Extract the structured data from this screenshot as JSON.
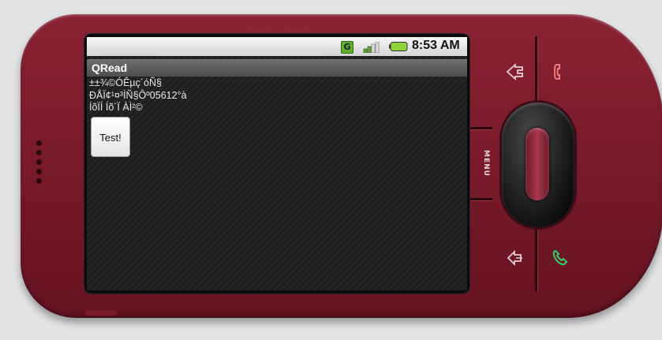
{
  "status_bar": {
    "network_badge": "G",
    "time": "8:53 AM",
    "icons": [
      "network-g-icon",
      "signal-icon",
      "battery-icon"
    ]
  },
  "app": {
    "title": "QRead",
    "lines": [
      "±±¾©ÓÊµç´óÑ§",
      "ÐÅÏ¢¹¤³ÌÑ§Ôº05612°à",
      "ÍõÏÍ Íõ´Ï ÀÌ²©"
    ],
    "test_button": "Test!"
  },
  "hardware": {
    "menu_label": "MENU",
    "icons": [
      "home-icon",
      "end-call-icon",
      "back-icon",
      "call-icon",
      "trackball"
    ]
  },
  "colors": {
    "device_body": "#7a1b2b",
    "screen_bg": "#222222",
    "title_bar": "#5a5a5a",
    "call_green": "#2fa84f",
    "end_call_red": "#e0606a"
  }
}
